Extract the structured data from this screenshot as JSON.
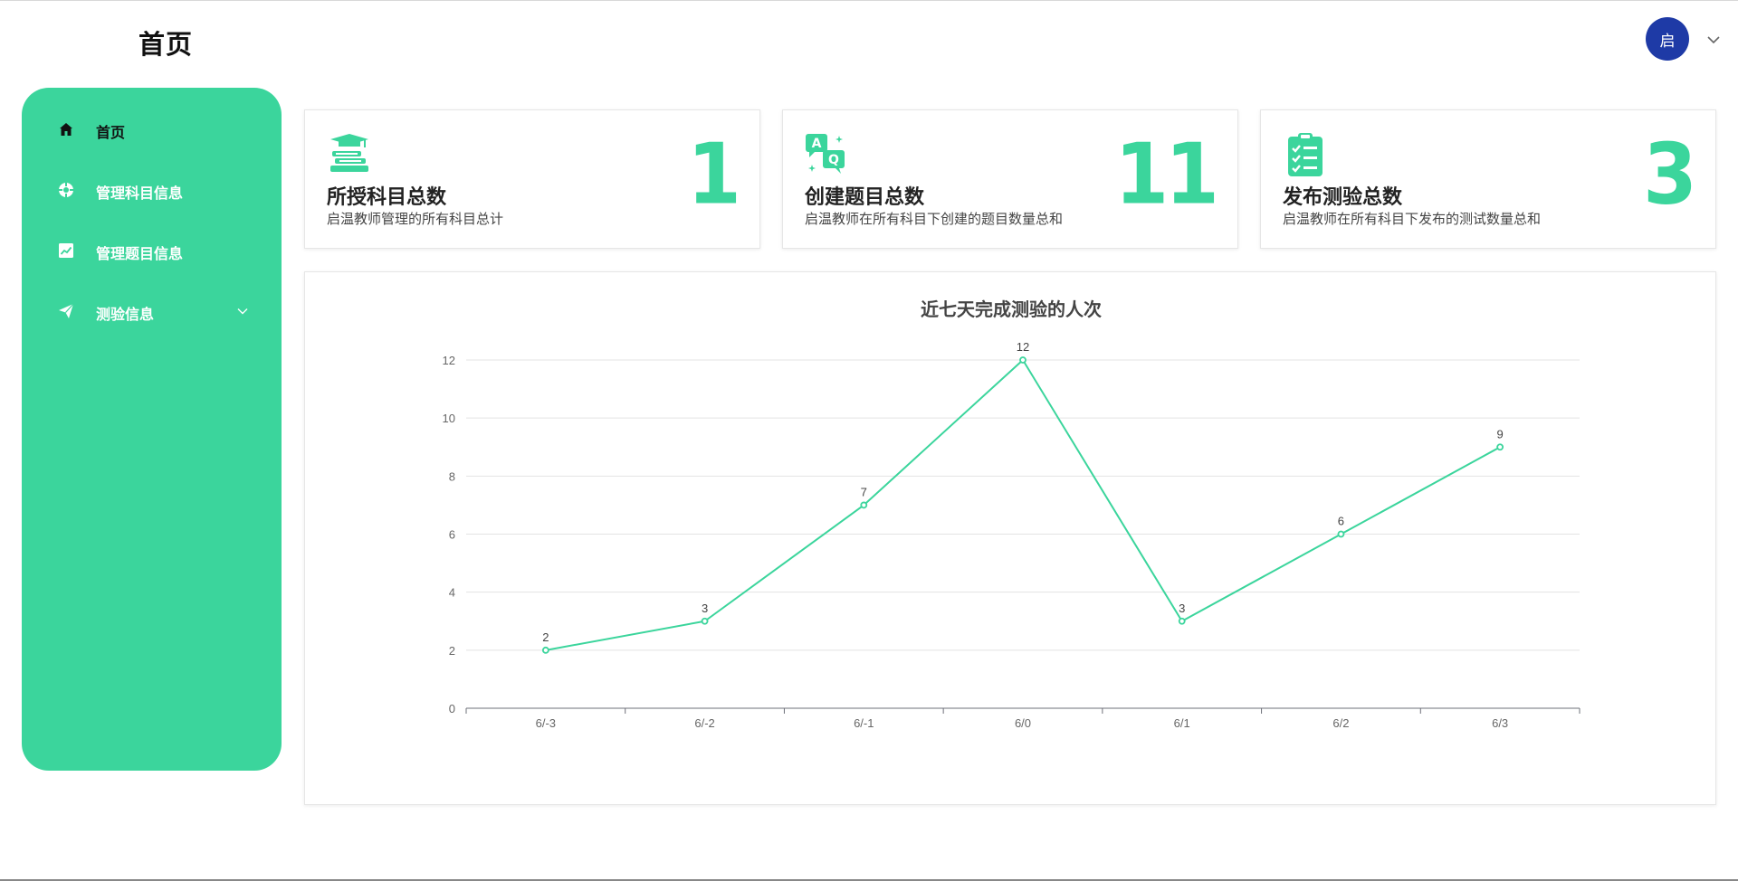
{
  "header": {
    "title": "首页",
    "avatar_text": "启"
  },
  "sidebar": {
    "items": [
      {
        "label": "首页",
        "icon": "home-icon",
        "active": true
      },
      {
        "label": "管理科目信息",
        "icon": "compass-icon"
      },
      {
        "label": "管理题目信息",
        "icon": "chart-icon"
      },
      {
        "label": "测验信息",
        "icon": "send-icon",
        "expandable": true
      }
    ]
  },
  "cards": [
    {
      "title": "所授科目总数",
      "desc": "启温教师管理的所有科目总计",
      "value": "1",
      "icon": "graduation-books-icon"
    },
    {
      "title": "创建题目总数",
      "desc": "启温教师在所有科目下创建的题目数量总和",
      "value": "11",
      "icon": "qa-bubbles-icon"
    },
    {
      "title": "发布测验总数",
      "desc": "启温教师在所有科目下发布的测试数量总和",
      "value": "3",
      "icon": "clipboard-checklist-icon"
    }
  ],
  "colors": {
    "accent": "#3bd59c",
    "avatar": "#1e3aa6"
  },
  "chart_data": {
    "type": "line",
    "title": "近七天完成测验的人次",
    "categories": [
      "6/-3",
      "6/-2",
      "6/-1",
      "6/0",
      "6/1",
      "6/2",
      "6/3"
    ],
    "values": [
      2,
      3,
      7,
      12,
      3,
      6,
      9
    ],
    "ylim": [
      0,
      12
    ],
    "yticks": [
      0,
      2,
      4,
      6,
      8,
      10,
      12
    ],
    "grid": true,
    "data_labels": true
  }
}
